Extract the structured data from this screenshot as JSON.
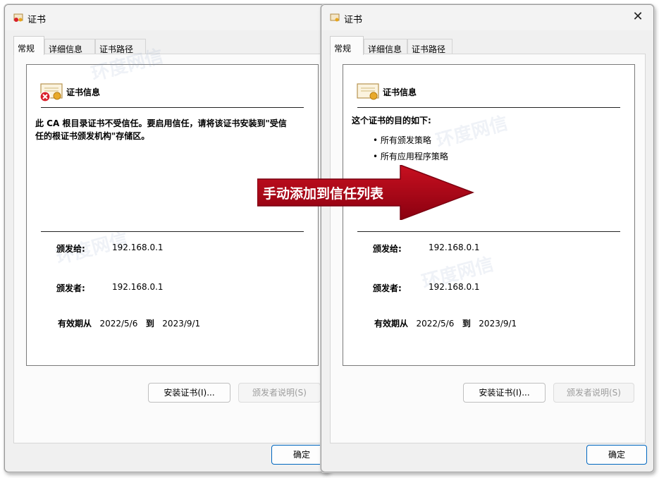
{
  "left_dialog": {
    "title": "证书",
    "tabs": [
      "常规",
      "详细信息",
      "证书路径"
    ],
    "heading": "证书信息",
    "warning": "此 CA 根目录证书不受信任。要启用信任，请将该证书安装到\"受信任的根证书颁发机构\"存储区。",
    "issued_to_label": "颁发给:",
    "issued_to": "192.168.0.1",
    "issued_by_label": "颁发者:",
    "issued_by": "192.168.0.1",
    "valid_from_label": "有效期从",
    "valid_from": "2022/5/6",
    "to_label": "到",
    "valid_to": "2023/9/1",
    "install_button": "安装证书(I)...",
    "issuer_statement_button": "颁发者说明(S)",
    "ok_button": "确定"
  },
  "right_dialog": {
    "title": "证书",
    "close": "✕",
    "tabs": [
      "常规",
      "详细信息",
      "证书路径"
    ],
    "heading": "证书信息",
    "purpose_title": "这个证书的目的如下:",
    "purposes": [
      "• 所有颁发策略",
      "• 所有应用程序策略"
    ],
    "issued_to_label": "颁发给:",
    "issued_to": "192.168.0.1",
    "issued_by_label": "颁发者:",
    "issued_by": "192.168.0.1",
    "valid_from_label": "有效期从",
    "valid_from": "2022/5/6",
    "to_label": "到",
    "valid_to": "2023/9/1",
    "install_button": "安装证书(I)...",
    "issuer_statement_button": "颁发者说明(S)",
    "ok_button": "确定"
  },
  "annotation": {
    "text": "手动添加到信任列表",
    "color": "#b00010"
  },
  "watermark": {
    "text": "环度网信"
  }
}
